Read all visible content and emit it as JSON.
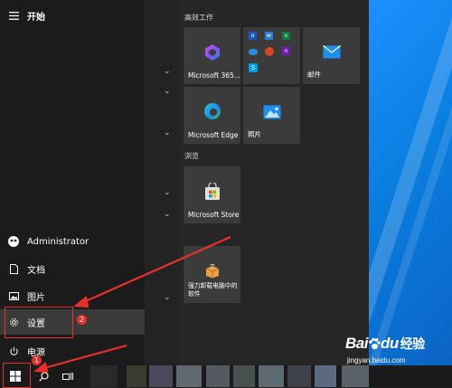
{
  "start_menu": {
    "header_label": "开始",
    "user_name": "Administrator",
    "rail_items": [
      {
        "label": "文档",
        "icon": "document-icon"
      },
      {
        "label": "图片",
        "icon": "picture-icon"
      },
      {
        "label": "设置",
        "icon": "gear-icon"
      },
      {
        "label": "电源",
        "icon": "power-icon"
      }
    ]
  },
  "tiles": {
    "groups": [
      {
        "title": "高效工作"
      },
      {
        "title": "浏览"
      }
    ],
    "microsoft365_label": "Microsoft 365...",
    "mail_label": "邮件",
    "edge_label": "Microsoft Edge",
    "photos_label": "照片",
    "store_label": "Microsoft Store",
    "uninstall_label": "强力卸载电脑中的软件"
  },
  "annotations": {
    "badge1": "1",
    "badge2": "2"
  },
  "watermark": {
    "brand": "Bai",
    "brand2": "du",
    "jingyan": "经验",
    "url": "jingyan.baidu.com"
  },
  "colors": {
    "annotation_red": "#e8302a",
    "accent_blue": "#0a7ee0"
  }
}
